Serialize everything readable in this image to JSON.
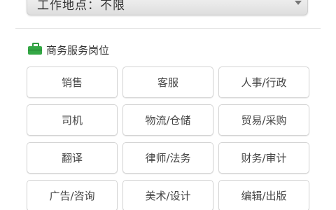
{
  "location_select": {
    "text": "工作地点：不限"
  },
  "section": {
    "title": "商务服务岗位"
  },
  "jobs": [
    "销售",
    "客服",
    "人事/行政",
    "司机",
    "物流/仓储",
    "贸易/采购",
    "翻译",
    "律师/法务",
    "财务/审计",
    "广告/咨询",
    "美术/设计",
    "编辑/出版"
  ],
  "colors": {
    "accent_green": "#34a845",
    "button_border": "#d4d4d4",
    "text": "#444444"
  }
}
